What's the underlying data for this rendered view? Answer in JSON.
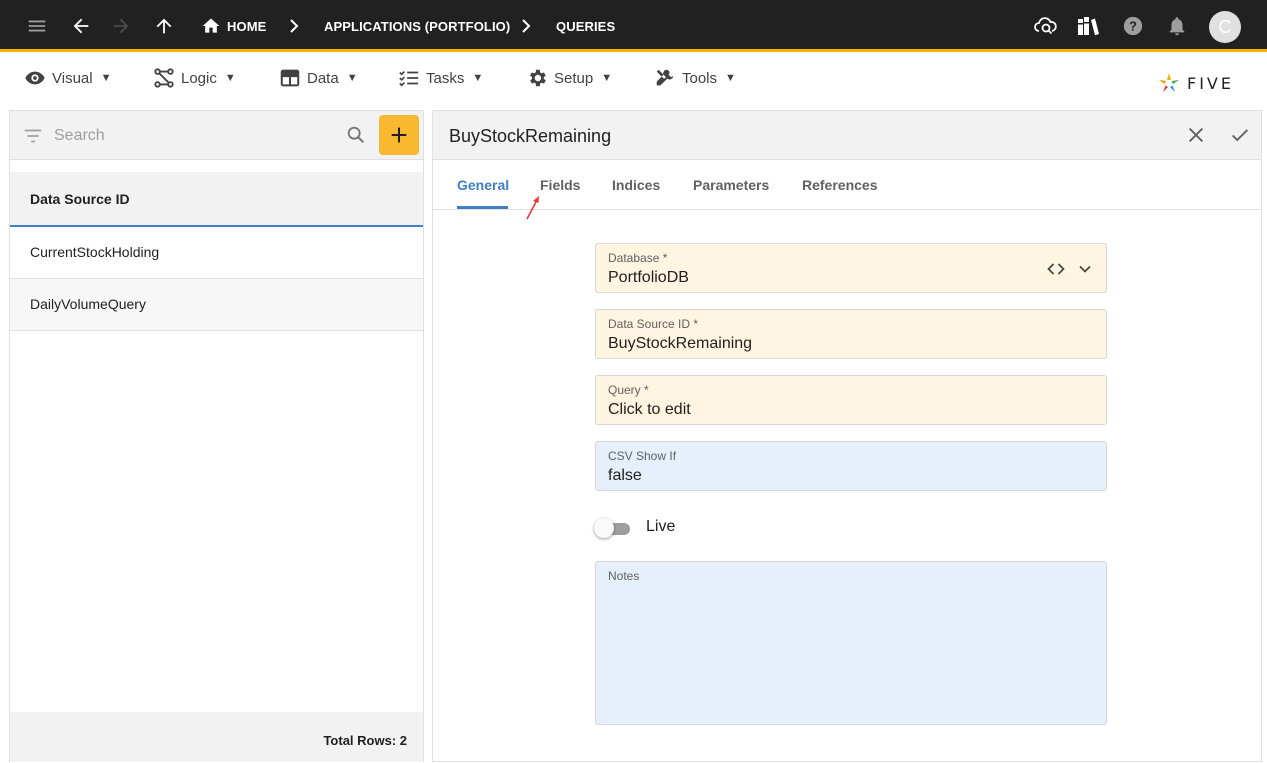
{
  "appbar": {
    "breadcrumbs": {
      "home": "HOME",
      "applications": "APPLICATIONS (PORTFOLIO)",
      "queries": "QUERIES"
    },
    "avatar_letter": "C",
    "icons": [
      "menu-icon",
      "back-arrow-icon",
      "forward-arrow-icon",
      "up-arrow-icon",
      "home-icon",
      "cloud-search-icon",
      "library-icon",
      "help-icon",
      "bell-icon"
    ]
  },
  "menubar": {
    "items": [
      {
        "label": "Visual",
        "icon": "eye-icon"
      },
      {
        "label": "Logic",
        "icon": "logic-icon"
      },
      {
        "label": "Data",
        "icon": "table-icon"
      },
      {
        "label": "Tasks",
        "icon": "checklist-icon"
      },
      {
        "label": "Setup",
        "icon": "gear-icon"
      },
      {
        "label": "Tools",
        "icon": "tools-icon"
      }
    ],
    "caret": "▼",
    "logo_text": "FIVE"
  },
  "list": {
    "search_placeholder": "Search",
    "header": "Data Source ID",
    "rows": [
      "CurrentStockHolding",
      "DailyVolumeQuery"
    ],
    "footer": "Total Rows: 2"
  },
  "form": {
    "title": "BuyStockRemaining",
    "tabs": [
      "General",
      "Fields",
      "Indices",
      "Parameters",
      "References"
    ],
    "active_tab": "General",
    "fields": {
      "database": {
        "label": "Database *",
        "value": "PortfolioDB"
      },
      "data_source_id": {
        "label": "Data Source ID *",
        "value": "BuyStockRemaining"
      },
      "query": {
        "label": "Query *",
        "value": "Click to edit"
      },
      "csv_show_if": {
        "label": "CSV Show If",
        "value": "false"
      },
      "live": {
        "label": "Live",
        "value": false
      },
      "notes": {
        "label": "Notes",
        "value": ""
      }
    }
  },
  "colors": {
    "appbar": "#212121",
    "accent": "#f4b400",
    "add_button": "#f9b82f",
    "active_tab": "#3f7fc4",
    "required_field": "#fff5e1",
    "optional_field": "#e5f0fb",
    "annotation_arrow": "#e53935"
  }
}
